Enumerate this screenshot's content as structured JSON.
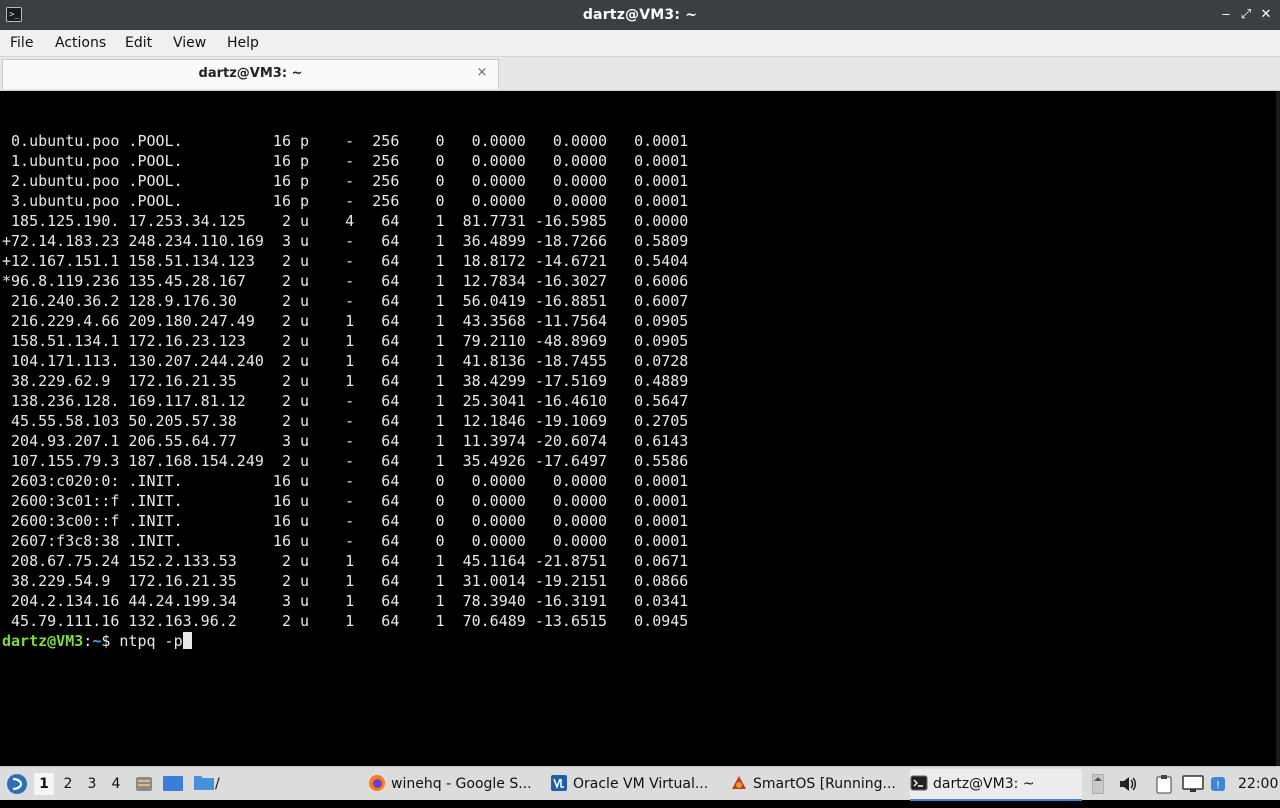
{
  "window": {
    "title": "dartz@VM3: ~",
    "minimize_glyph": "‒",
    "restore_glyph": "⤢",
    "close_glyph": "✕",
    "icon_glyph": ">_"
  },
  "menubar": {
    "items": [
      "File",
      "Actions",
      "Edit",
      "View",
      "Help"
    ]
  },
  "tabs": [
    {
      "label": "dartz@VM3: ~",
      "close_glyph": "×"
    }
  ],
  "terminal": {
    "lines": [
      " 0.ubuntu.poo .POOL.          16 p    -  256    0   0.0000   0.0000   0.0001",
      " 1.ubuntu.poo .POOL.          16 p    -  256    0   0.0000   0.0000   0.0001",
      " 2.ubuntu.poo .POOL.          16 p    -  256    0   0.0000   0.0000   0.0001",
      " 3.ubuntu.poo .POOL.          16 p    -  256    0   0.0000   0.0000   0.0001",
      " 185.125.190. 17.253.34.125    2 u    4   64    1  81.7731 -16.5985   0.0000",
      "+72.14.183.23 248.234.110.169  3 u    -   64    1  36.4899 -18.7266   0.5809",
      "+12.167.151.1 158.51.134.123   2 u    -   64    1  18.8172 -14.6721   0.5404",
      "*96.8.119.236 135.45.28.167    2 u    -   64    1  12.7834 -16.3027   0.6006",
      " 216.240.36.2 128.9.176.30     2 u    -   64    1  56.0419 -16.8851   0.6007",
      " 216.229.4.66 209.180.247.49   2 u    1   64    1  43.3568 -11.7564   0.0905",
      " 158.51.134.1 172.16.23.123    2 u    1   64    1  79.2110 -48.8969   0.0905",
      " 104.171.113. 130.207.244.240  2 u    1   64    1  41.8136 -18.7455   0.0728",
      " 38.229.62.9  172.16.21.35     2 u    1   64    1  38.4299 -17.5169   0.4889",
      " 138.236.128. 169.117.81.12    2 u    -   64    1  25.3041 -16.4610   0.5647",
      " 45.55.58.103 50.205.57.38     2 u    -   64    1  12.1846 -19.1069   0.2705",
      " 204.93.207.1 206.55.64.77     3 u    -   64    1  11.3974 -20.6074   0.6143",
      " 107.155.79.3 187.168.154.249  2 u    -   64    1  35.4926 -17.6497   0.5586",
      " 2603:c020:0: .INIT.          16 u    -   64    0   0.0000   0.0000   0.0001",
      " 2600:3c01::f .INIT.          16 u    -   64    0   0.0000   0.0000   0.0001",
      " 2600:3c00::f .INIT.          16 u    -   64    0   0.0000   0.0000   0.0001",
      " 2607:f3c8:38 .INIT.          16 u    -   64    0   0.0000   0.0000   0.0001",
      " 208.67.75.24 152.2.133.53     2 u    1   64    1  45.1164 -21.8751   0.0671",
      " 38.229.54.9  172.16.21.35     2 u    1   64    1  31.0014 -19.2151   0.0866",
      " 204.2.134.16 44.24.199.34     3 u    1   64    1  78.3940 -16.3191   0.0341",
      " 45.79.111.16 132.163.96.2     2 u    1   64    1  70.6489 -13.6515   0.0945"
    ],
    "prompt": {
      "user_host": "dartz@VM3",
      "colon": ":",
      "path": "~",
      "symbol": "$ ",
      "command": "ntpq -p"
    }
  },
  "taskbar": {
    "workspaces": [
      "1",
      "2",
      "3",
      "4"
    ],
    "path_label": "/",
    "tasks": [
      {
        "label": "winehq - Google S...",
        "icon": "firefox-icon"
      },
      {
        "label": "Oracle VM Virtual...",
        "icon": "virtualbox-icon"
      },
      {
        "label": "SmartOS [Running...",
        "icon": "vm-running-icon"
      },
      {
        "label": "dartz@VM3: ~",
        "icon": "terminal-icon"
      }
    ],
    "clock": "22:00"
  },
  "colors": {
    "prompt_user": "#7ddc3f",
    "prompt_path": "#5c9cff",
    "accent": "#3d87d6"
  }
}
